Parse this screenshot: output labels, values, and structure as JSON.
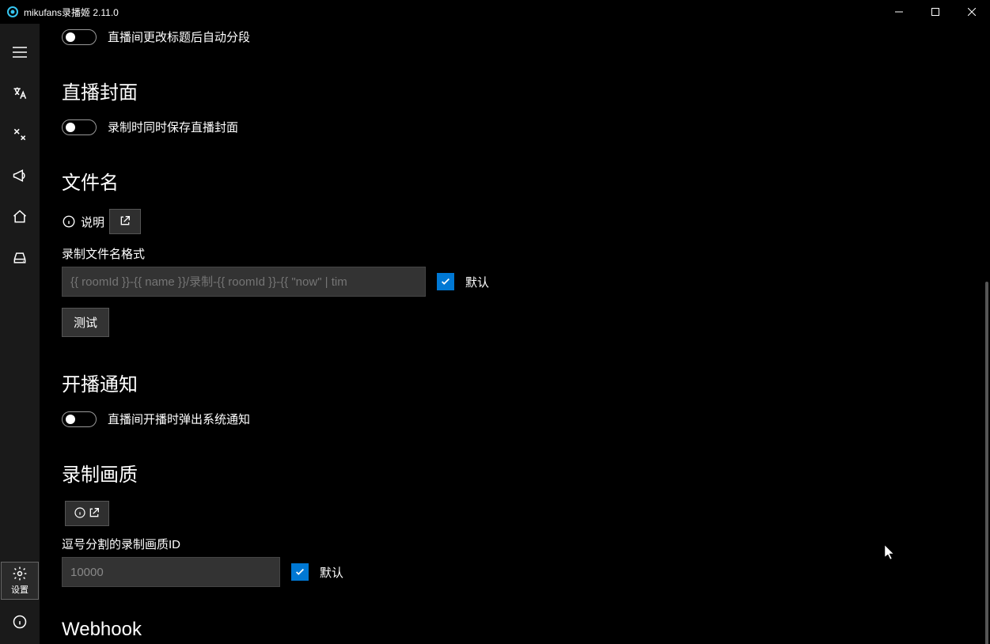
{
  "titlebar": {
    "title": "mikufans录播姬 2.11.0"
  },
  "sidebar": {
    "settings_label": "设置"
  },
  "sections": {
    "top_toggle": {
      "label": "直播间更改标题后自动分段"
    },
    "cover": {
      "title": "直播封面",
      "toggle_label": "录制时同时保存直播封面"
    },
    "filename": {
      "title": "文件名",
      "desc_label": "说明",
      "field_label": "录制文件名格式",
      "placeholder": "{{ roomId }}-{{ name }}/录制-{{ roomId }}-{{ \"now\" | tim",
      "default_label": "默认",
      "test_button": "测试"
    },
    "notification": {
      "title": "开播通知",
      "toggle_label": "直播间开播时弹出系统通知"
    },
    "quality": {
      "title": "录制画质",
      "field_label": "逗号分割的录制画质ID",
      "value": "10000",
      "default_label": "默认"
    },
    "webhook": {
      "title": "Webhook"
    }
  }
}
